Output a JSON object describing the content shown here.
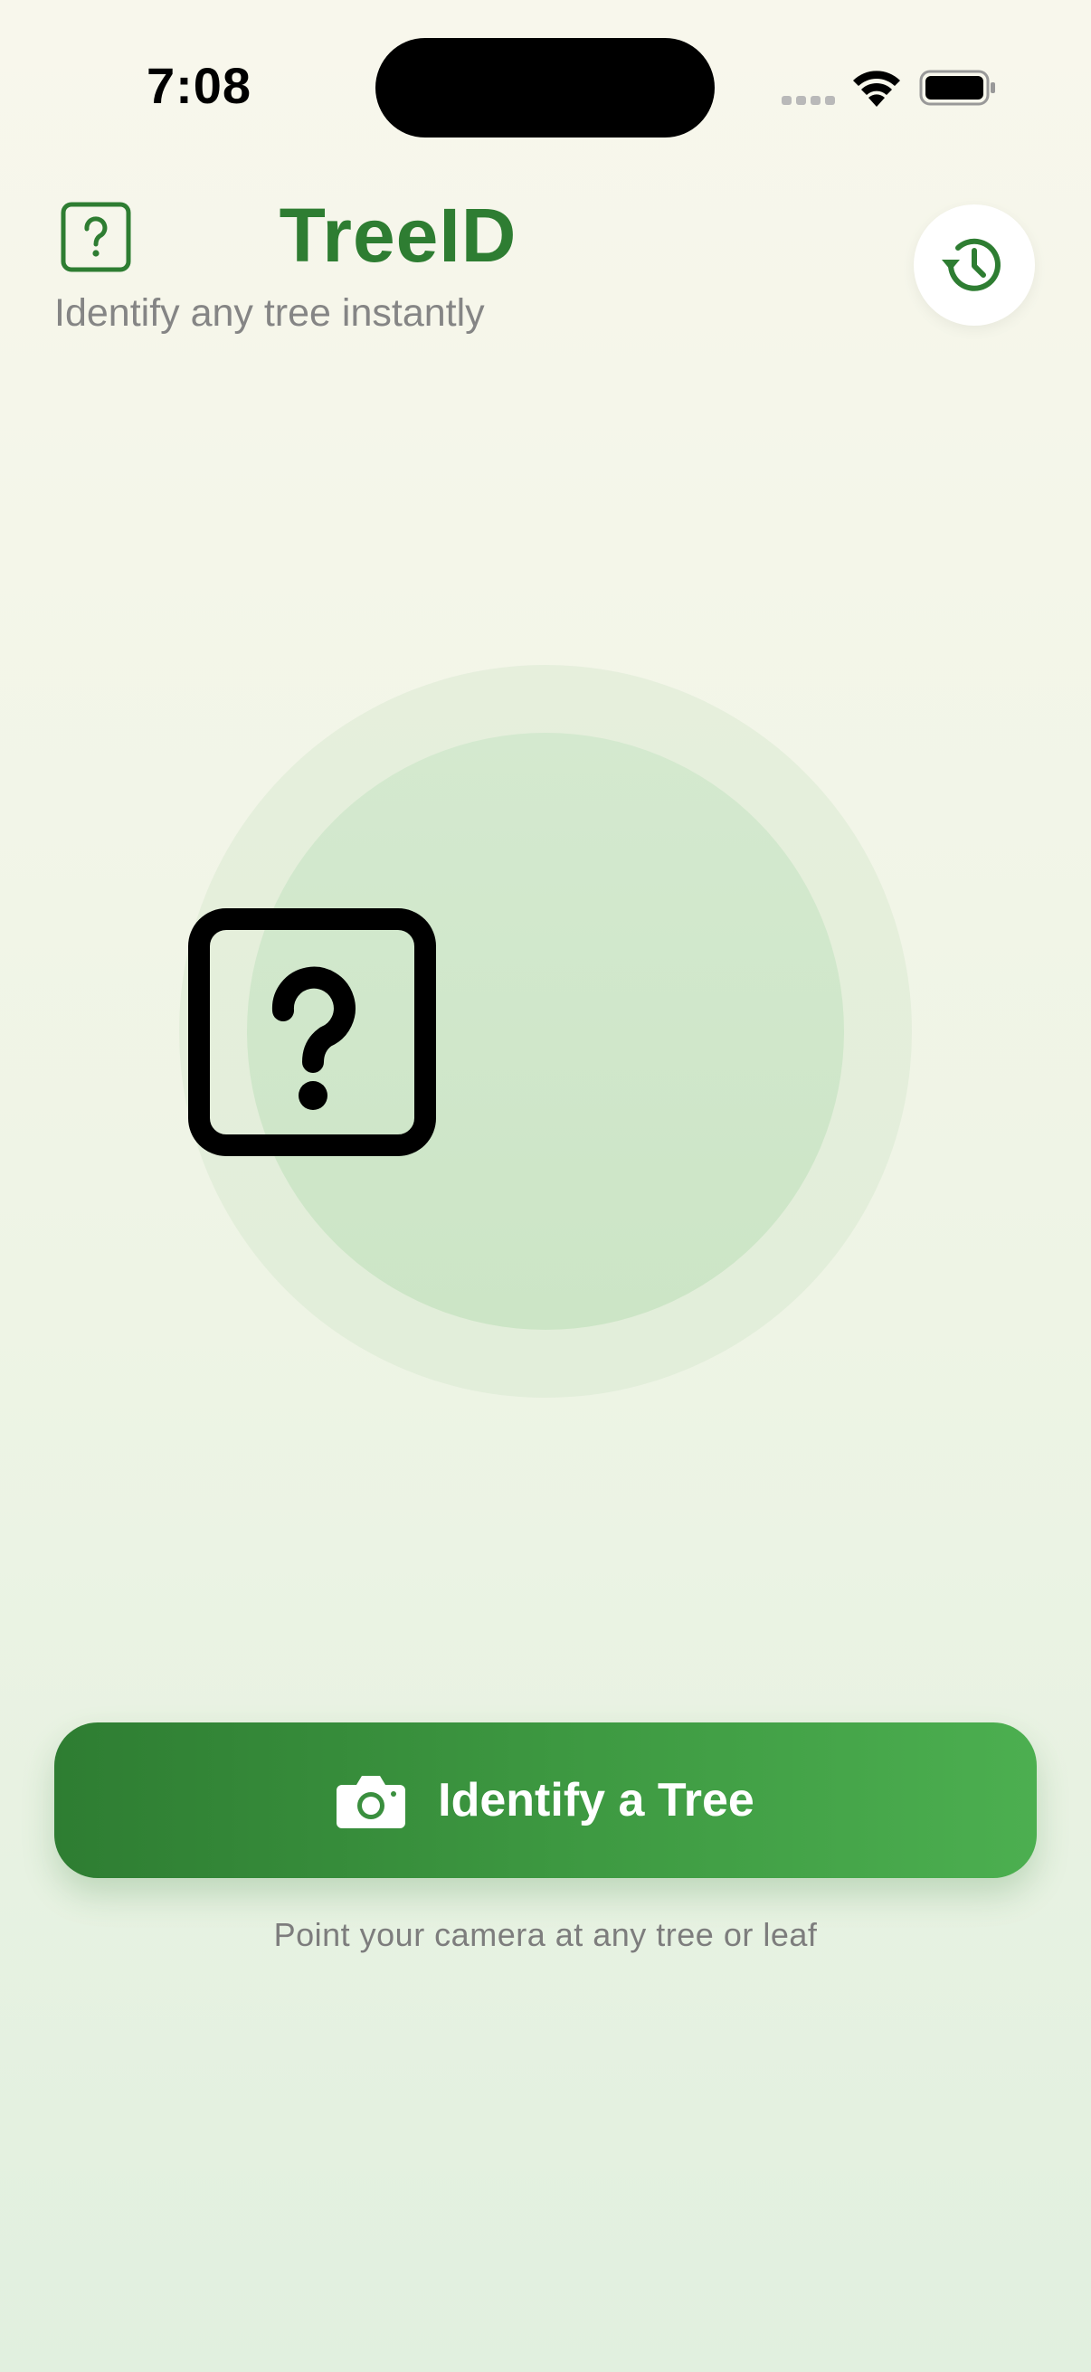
{
  "status_bar": {
    "time": "7:08",
    "icons": [
      "cellular-signal-icon",
      "wifi-icon",
      "battery-icon"
    ]
  },
  "header": {
    "title": "TreeID",
    "subtitle": "Identify any tree instantly",
    "left_icon": "question-square-icon",
    "history_button_icon": "history-clock-icon"
  },
  "hero": {
    "icon": "question-square-icon"
  },
  "primary_action": {
    "icon": "camera-icon",
    "label": "Identify a Tree"
  },
  "hint": "Point your camera at any tree or leaf",
  "colors": {
    "brand_green": "#2e7d32",
    "brand_green_light": "#4caf50",
    "background_top": "#f8f7ec",
    "background_bottom": "#e1f0df",
    "hero_circle": "#d4e9cf"
  }
}
